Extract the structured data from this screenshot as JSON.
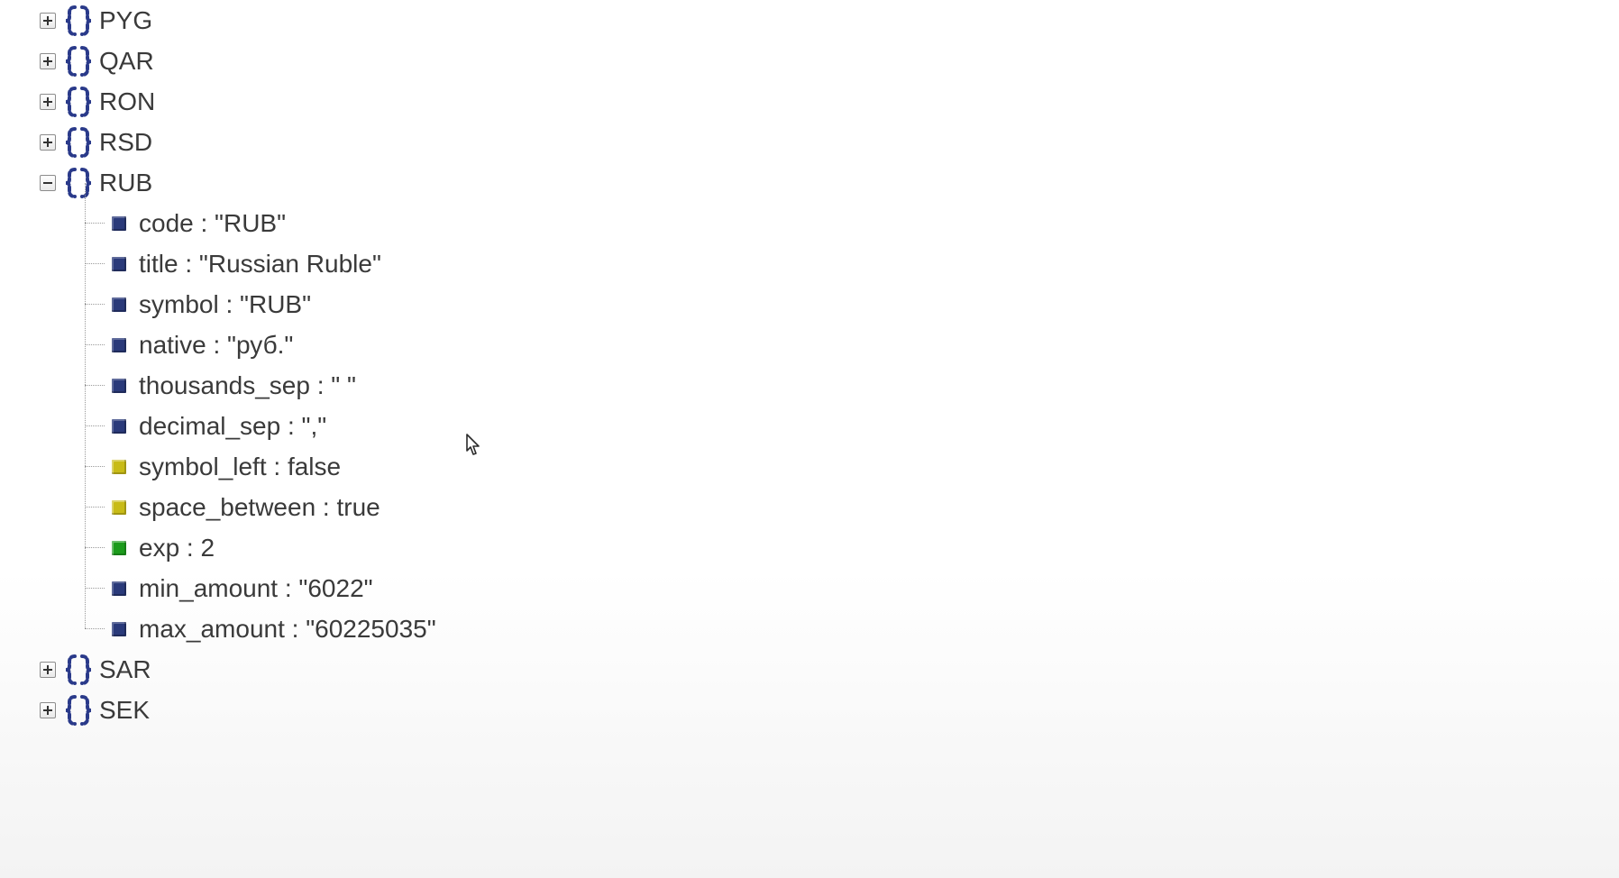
{
  "tree": {
    "nodes": [
      {
        "key": "PYG",
        "expanded": false
      },
      {
        "key": "QAR",
        "expanded": false
      },
      {
        "key": "RON",
        "expanded": false
      },
      {
        "key": "RSD",
        "expanded": false
      },
      {
        "key": "RUB",
        "expanded": true,
        "children": [
          {
            "type": "string",
            "label": "code : \"RUB\""
          },
          {
            "type": "string",
            "label": "title : \"Russian Ruble\""
          },
          {
            "type": "string",
            "label": "symbol : \"RUB\""
          },
          {
            "type": "string",
            "label": "native : \"руб.\""
          },
          {
            "type": "string",
            "label": "thousands_sep : \" \""
          },
          {
            "type": "string",
            "label": "decimal_sep : \",\""
          },
          {
            "type": "bool",
            "label": "symbol_left : false"
          },
          {
            "type": "bool",
            "label": "space_between : true"
          },
          {
            "type": "number",
            "label": "exp : 2"
          },
          {
            "type": "string",
            "label": "min_amount : \"6022\""
          },
          {
            "type": "string",
            "label": "max_amount : \"60225035\""
          }
        ]
      },
      {
        "key": "SAR",
        "expanded": false
      },
      {
        "key": "SEK",
        "expanded": false
      }
    ]
  }
}
